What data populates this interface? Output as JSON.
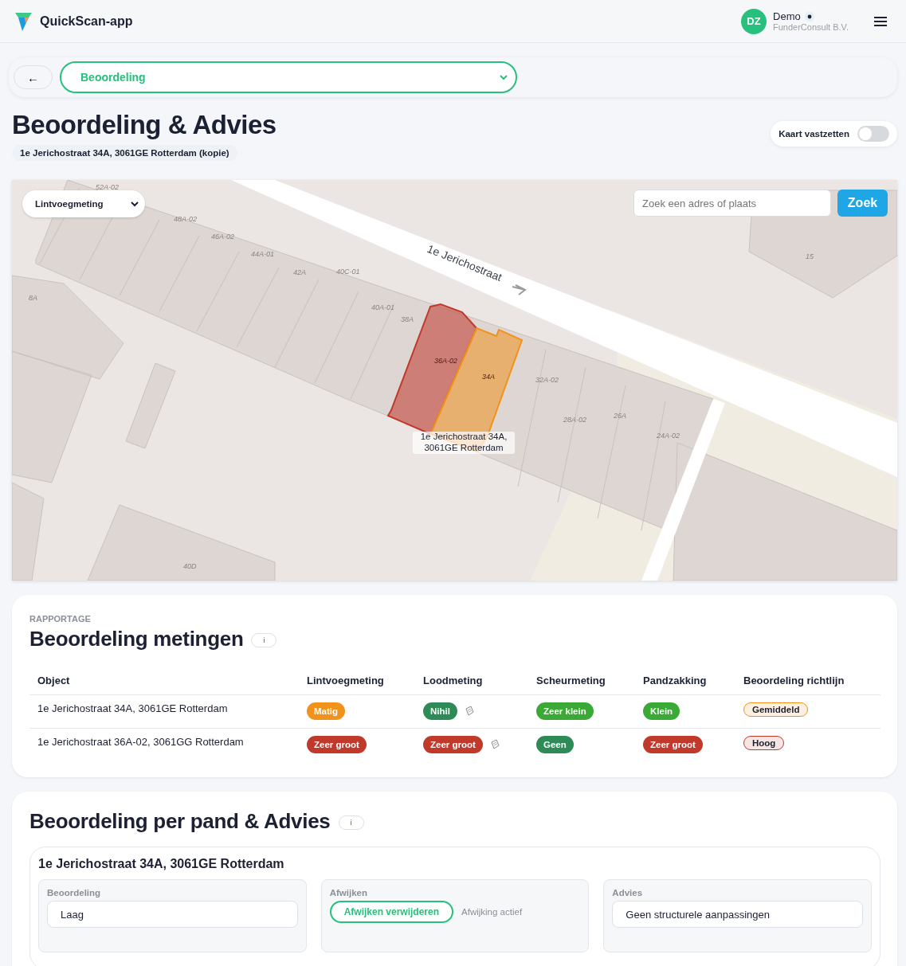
{
  "header": {
    "app_name": "QuickScan-app",
    "user": {
      "initials": "DZ",
      "name": "Demo",
      "company": "FunderConsult B.V."
    }
  },
  "nav": {
    "back": "←",
    "section_select": "Beoordeling"
  },
  "page": {
    "title": "Beoordeling & Advies",
    "address_chip": "1e Jerichostraat 34A, 3061GE Rotterdam (kopie)",
    "lock_map": {
      "label": "Kaart vastzetten",
      "on": false
    }
  },
  "map": {
    "layer_select": "Lintvoegmeting",
    "search": {
      "placeholder": "Zoek een adres of plaats",
      "button": "Zoek"
    },
    "street_label": "1e Jerichostraat",
    "selected_label": "1e Jerichostraat 34A, 3061GE Rotterdam",
    "house_numbers": [
      "52A-02",
      "48A-02",
      "46A-02",
      "44A-01",
      "42A",
      "40C-01",
      "40A-01",
      "38A",
      "32A-02",
      "28A-02",
      "26A",
      "24A-02",
      "8A",
      "15",
      "40D"
    ],
    "highlights": [
      {
        "label": "36A-02",
        "color": "#c0392b"
      },
      {
        "label": "34A",
        "color": "#f0921c"
      }
    ]
  },
  "report": {
    "eyebrow": "RAPPORTAGE",
    "title": "Beoordeling metingen",
    "info": "i",
    "columns": [
      "Object",
      "Lintvoegmeting",
      "Loodmeting",
      "Scheurmeting",
      "Pandzakking",
      "Beoordeling richtlijn"
    ],
    "rows": [
      {
        "cells": [
          {
            "text": "1e Jerichostraat 34A, 3061GE Rotterdam",
            "kind": "text"
          },
          {
            "text": "Matig",
            "kind": "fill",
            "color": "#f0921c",
            "attachment": false
          },
          {
            "text": "Nihil",
            "kind": "fill",
            "color": "#2e8b57",
            "attachment": true
          },
          {
            "text": "Zeer klein",
            "kind": "fill",
            "color": "#3aa935",
            "attachment": false
          },
          {
            "text": "Klein",
            "kind": "fill",
            "color": "#3aa935",
            "attachment": false
          },
          {
            "text": "Gemiddeld",
            "kind": "outline",
            "color": "#f0921c",
            "attachment": false
          }
        ]
      },
      {
        "cells": [
          {
            "text": "1e Jerichostraat 36A-02, 3061GG Rotterdam",
            "kind": "text"
          },
          {
            "text": "Zeer groot",
            "kind": "fill",
            "color": "#c0392b",
            "attachment": false
          },
          {
            "text": "Zeer groot",
            "kind": "fill",
            "color": "#c0392b",
            "attachment": true
          },
          {
            "text": "Geen",
            "kind": "fill",
            "color": "#2e8b57",
            "attachment": false
          },
          {
            "text": "Zeer groot",
            "kind": "fill",
            "color": "#c0392b",
            "attachment": false
          },
          {
            "text": "Hoog",
            "kind": "outline",
            "color": "#c0392b",
            "attachment": false
          }
        ]
      }
    ]
  },
  "advice": {
    "title": "Beoordeling per pand & Advies",
    "info": "i",
    "building": {
      "title": "1e Jerichostraat 34A, 3061GE Rotterdam",
      "panels": [
        {
          "kind": "select",
          "label": "Beoordeling",
          "value": "Laag"
        },
        {
          "kind": "deviation",
          "label": "Afwijken",
          "button": "Afwijken verwijderen",
          "status": "Afwijking actief"
        },
        {
          "kind": "select",
          "label": "Advies",
          "value": "Geen structurele aanpassingen"
        }
      ]
    }
  }
}
